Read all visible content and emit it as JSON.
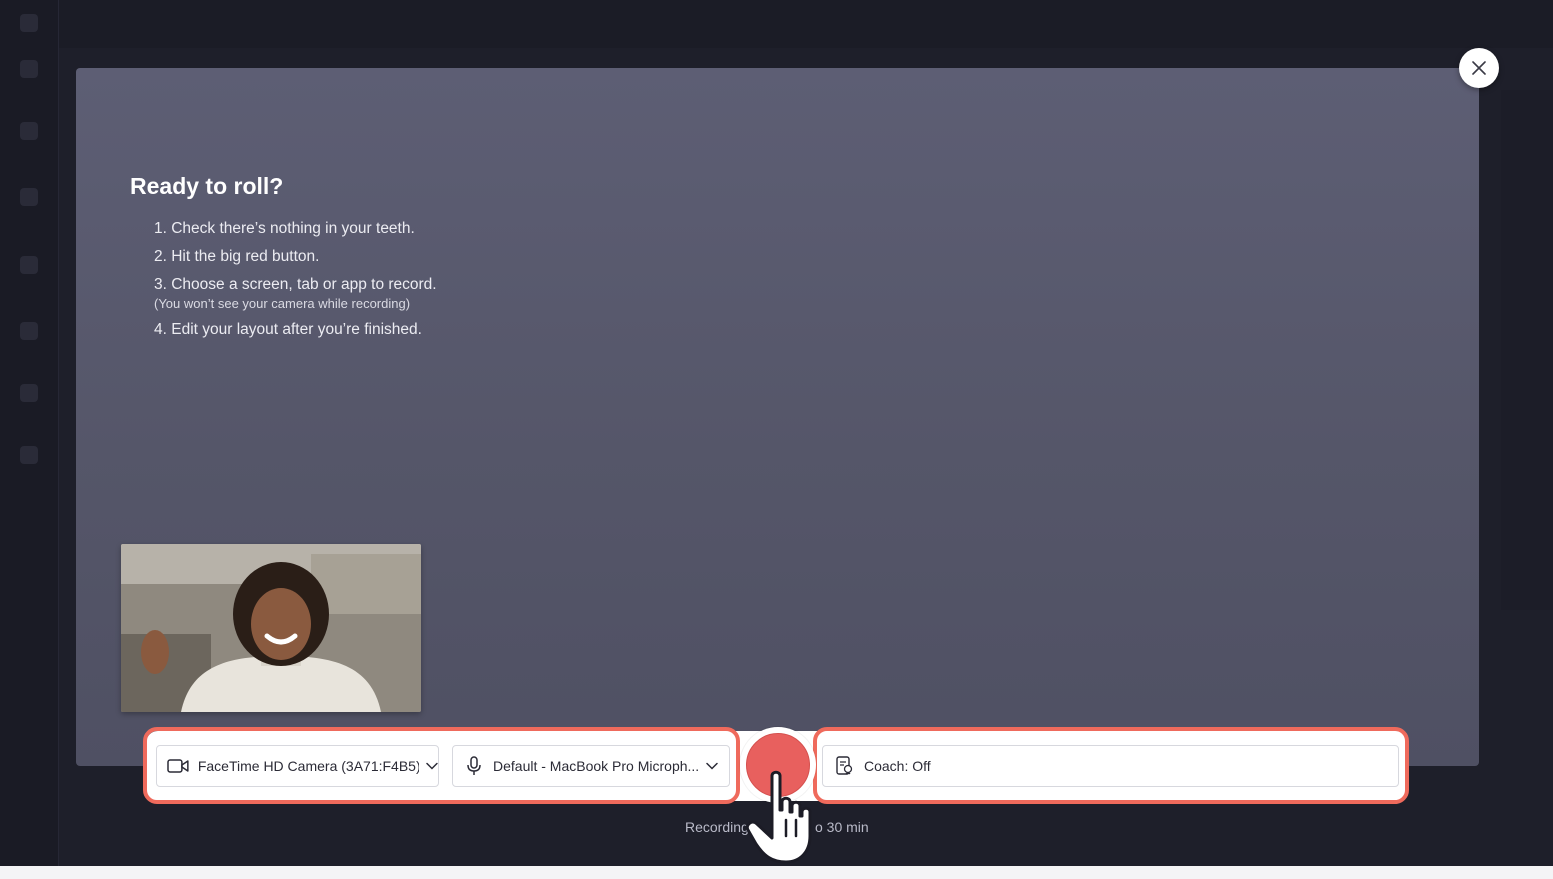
{
  "modal": {
    "title": "Ready to roll?",
    "steps": [
      "1. Check there’s nothing in your teeth.",
      "2. Hit the big red button.",
      "3. Choose a screen, tab or app to record.",
      "4. Edit your layout after you’re finished."
    ],
    "step3_note": "(You won’t see your camera while recording)",
    "close_icon": "close-icon"
  },
  "controls": {
    "camera_label": "FaceTime HD Camera (3A71:F4B5)",
    "mic_label": "Default - MacBook Pro Microph...",
    "coach_label": "Coach: Off",
    "recording_note_left": "Recording",
    "recording_note_right": "o 30 min"
  },
  "colors": {
    "record": "#e8605e",
    "highlight": "#ef6a5c",
    "modal_bg": "#585970",
    "page_bg": "#1e1f2a"
  },
  "icons": {
    "camera": "video-camera-icon",
    "microphone": "microphone-icon",
    "coach": "speaker-coach-icon",
    "chevron": "chevron-down-icon",
    "cursor": "pointer-hand-icon"
  }
}
